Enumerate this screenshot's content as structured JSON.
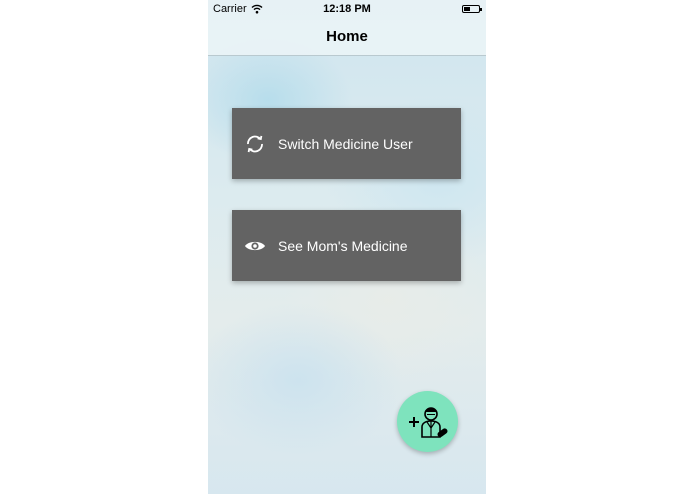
{
  "status_bar": {
    "carrier": "Carrier",
    "time": "12:18 PM",
    "icons": [
      "wifi-icon",
      "battery-icon"
    ]
  },
  "nav": {
    "title": "Home"
  },
  "actions": [
    {
      "label": "Switch Medicine User",
      "icon": "refresh-icon"
    },
    {
      "label": "See Mom's Medicine",
      "icon": "eye-icon"
    }
  ],
  "fab": {
    "icon": "add-doctor-icon"
  },
  "colors": {
    "card": "#636363",
    "card_text": "#ffffff",
    "fab": "#7ee3bd"
  }
}
